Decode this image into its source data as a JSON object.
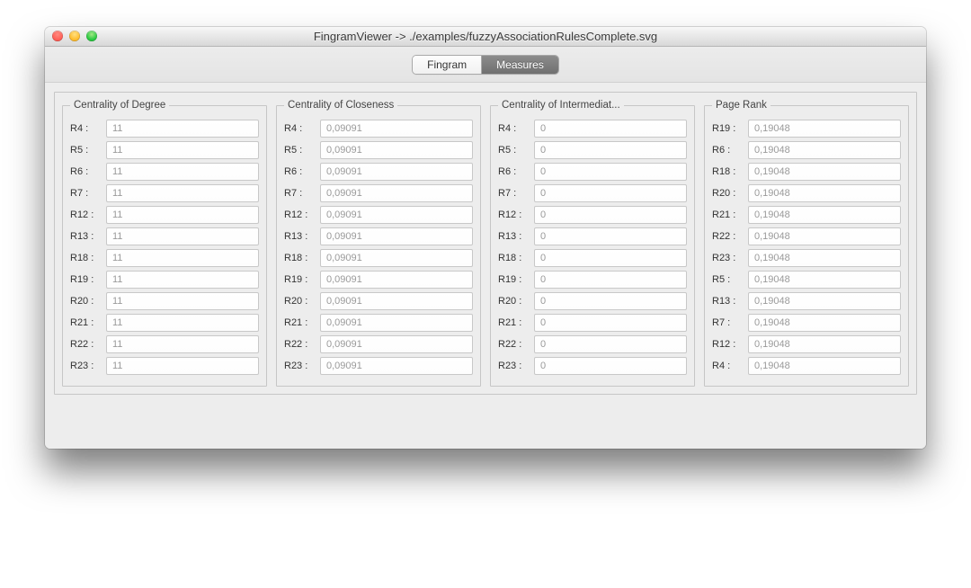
{
  "window": {
    "title": "FingramViewer -> ./examples/fuzzyAssociationRulesComplete.svg"
  },
  "tabs": {
    "fingram": "Fingram",
    "measures": "Measures",
    "active": "measures"
  },
  "groups": [
    {
      "title": "Centrality of Degree",
      "rows": [
        {
          "label": "R4 :",
          "value": "11"
        },
        {
          "label": "R5 :",
          "value": "11"
        },
        {
          "label": "R6 :",
          "value": "11"
        },
        {
          "label": "R7 :",
          "value": "11"
        },
        {
          "label": "R12 :",
          "value": "11"
        },
        {
          "label": "R13 :",
          "value": "11"
        },
        {
          "label": "R18 :",
          "value": "11"
        },
        {
          "label": "R19 :",
          "value": "11"
        },
        {
          "label": "R20 :",
          "value": "11"
        },
        {
          "label": "R21 :",
          "value": "11"
        },
        {
          "label": "R22 :",
          "value": "11"
        },
        {
          "label": "R23 :",
          "value": "11"
        }
      ]
    },
    {
      "title": "Centrality of Closeness",
      "rows": [
        {
          "label": "R4 :",
          "value": "0,09091"
        },
        {
          "label": "R5 :",
          "value": "0,09091"
        },
        {
          "label": "R6 :",
          "value": "0,09091"
        },
        {
          "label": "R7 :",
          "value": "0,09091"
        },
        {
          "label": "R12 :",
          "value": "0,09091"
        },
        {
          "label": "R13 :",
          "value": "0,09091"
        },
        {
          "label": "R18 :",
          "value": "0,09091"
        },
        {
          "label": "R19 :",
          "value": "0,09091"
        },
        {
          "label": "R20 :",
          "value": "0,09091"
        },
        {
          "label": "R21 :",
          "value": "0,09091"
        },
        {
          "label": "R22 :",
          "value": "0,09091"
        },
        {
          "label": "R23 :",
          "value": "0,09091"
        }
      ]
    },
    {
      "title": "Centrality of Intermediat...",
      "rows": [
        {
          "label": "R4 :",
          "value": "0"
        },
        {
          "label": "R5 :",
          "value": "0"
        },
        {
          "label": "R6 :",
          "value": "0"
        },
        {
          "label": "R7 :",
          "value": "0"
        },
        {
          "label": "R12 :",
          "value": "0"
        },
        {
          "label": "R13 :",
          "value": "0"
        },
        {
          "label": "R18 :",
          "value": "0"
        },
        {
          "label": "R19 :",
          "value": "0"
        },
        {
          "label": "R20 :",
          "value": "0"
        },
        {
          "label": "R21 :",
          "value": "0"
        },
        {
          "label": "R22 :",
          "value": "0"
        },
        {
          "label": "R23 :",
          "value": "0"
        }
      ]
    },
    {
      "title": "Page Rank",
      "rows": [
        {
          "label": "R19 :",
          "value": "0,19048"
        },
        {
          "label": "R6 :",
          "value": "0,19048"
        },
        {
          "label": "R18 :",
          "value": "0,19048"
        },
        {
          "label": "R20 :",
          "value": "0,19048"
        },
        {
          "label": "R21 :",
          "value": "0,19048"
        },
        {
          "label": "R22 :",
          "value": "0,19048"
        },
        {
          "label": "R23 :",
          "value": "0,19048"
        },
        {
          "label": "R5 :",
          "value": "0,19048"
        },
        {
          "label": "R13 :",
          "value": "0,19048"
        },
        {
          "label": "R7 :",
          "value": "0,19048"
        },
        {
          "label": "R12 :",
          "value": "0,19048"
        },
        {
          "label": "R4 :",
          "value": "0,19048"
        }
      ]
    }
  ]
}
